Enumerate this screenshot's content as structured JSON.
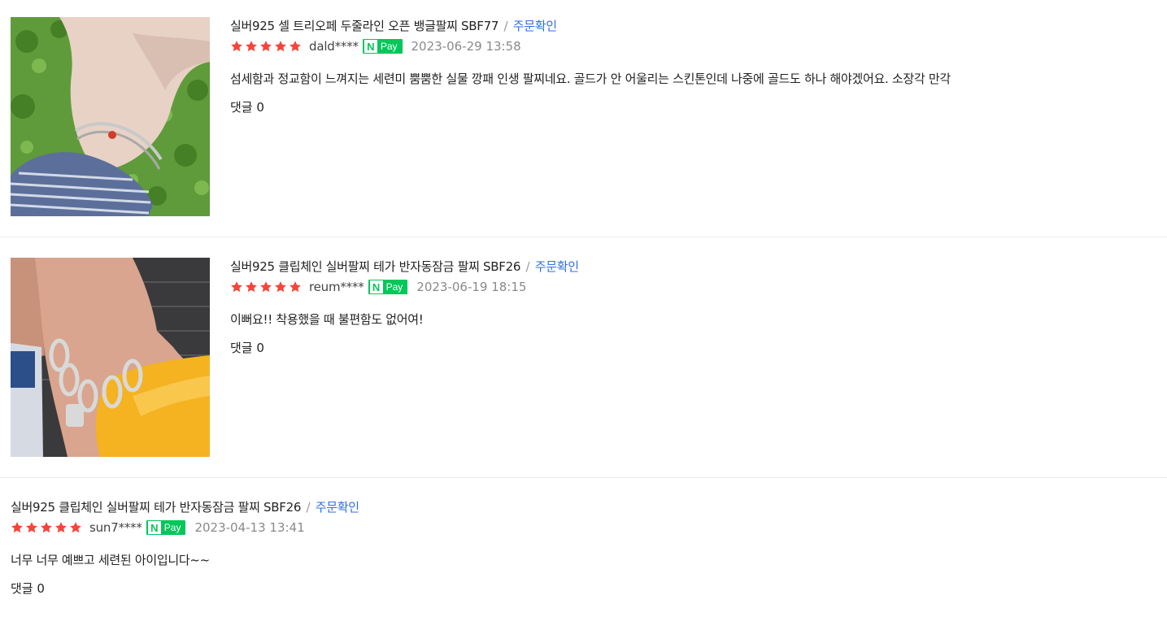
{
  "reviews": [
    {
      "product": "실버925 셀 트리오페 두줄라인 오픈 뱅글팔찌 SBF77",
      "separator": "/",
      "order_confirm": "주문확인",
      "rating": 5,
      "reviewer": "dald****",
      "npay_n": "N",
      "npay_label": "Pay",
      "date": "2023-06-29 13:58",
      "content": "섬세함과 정교함이 느껴지는 세련미 뿜뿜한 실물 깡패 인생 팔찌네요. 골드가 안 어울리는 스킨톤인데 나중에 골드도 하나 해야겠어요. 소장각 만각",
      "comments": "댓글 0",
      "has_photo": true
    },
    {
      "product": "실버925 클립체인 실버팔찌 테가 반자동잠금 팔찌 SBF26",
      "separator": "/",
      "order_confirm": "주문확인",
      "rating": 5,
      "reviewer": "reum****",
      "npay_n": "N",
      "npay_label": "Pay",
      "date": "2023-06-19 18:15",
      "content": "이뻐요!! 착용했을 때 불편함도 없어여!",
      "comments": "댓글 0",
      "has_photo": true
    },
    {
      "product": "실버925 클립체인 실버팔찌 테가 반자동잠금 팔찌 SBF26",
      "separator": "/",
      "order_confirm": "주문확인",
      "rating": 5,
      "reviewer": "sun7****",
      "npay_n": "N",
      "npay_label": "Pay",
      "date": "2023-04-13 13:41",
      "content": "너무 너무 예쁘고 세련된 아이입니다~~",
      "comments": "댓글 0",
      "has_photo": false
    }
  ],
  "colors": {
    "star": "#f5453b",
    "link": "#2f6fe4",
    "npay": "#03c75a",
    "date": "#8a8a8a"
  }
}
